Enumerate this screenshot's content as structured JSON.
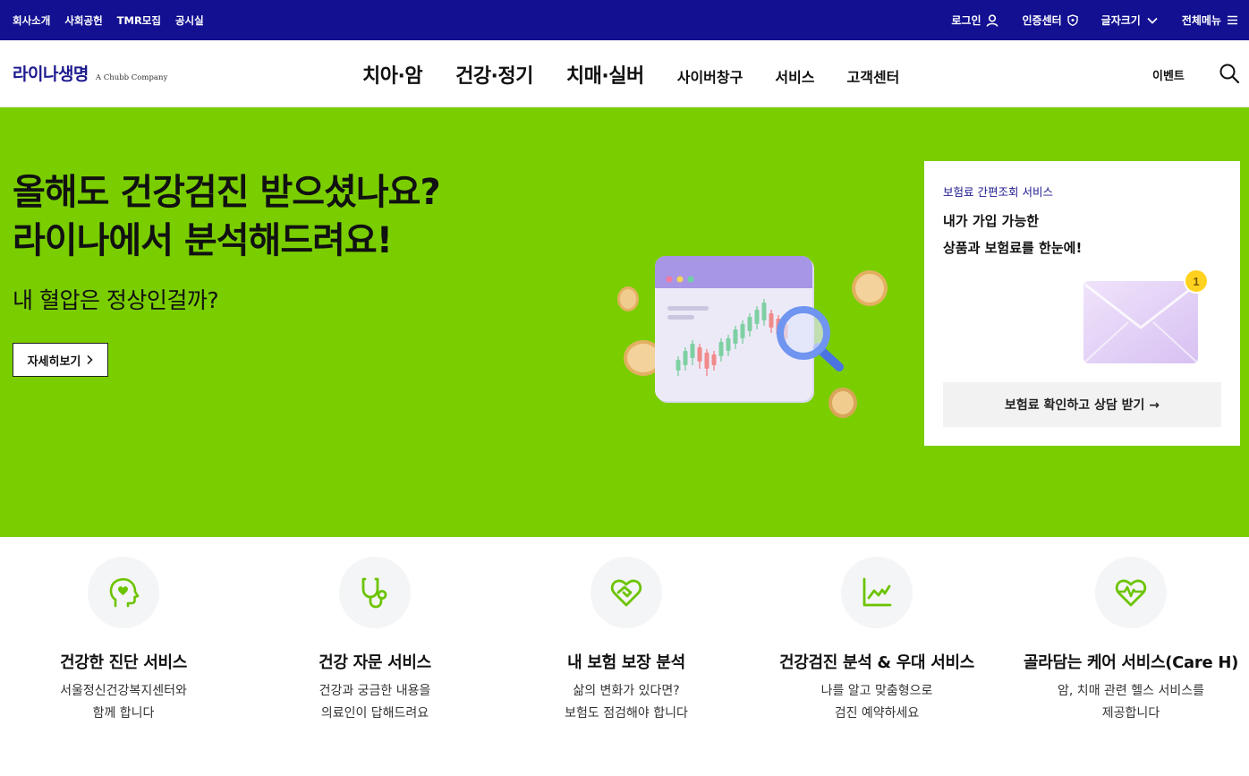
{
  "utility": {
    "links": [
      "회사소개",
      "사회공헌",
      "TMR모집",
      "공시실"
    ],
    "login": "로그인",
    "cert": "인증센터",
    "fontsize": "글자크기",
    "allmenu": "전체메뉴"
  },
  "header": {
    "brand": "라이나생명",
    "sub": "A Chubb Company",
    "nav_big": [
      "치아·암",
      "건강·정기",
      "치매·실버"
    ],
    "nav_small": [
      "사이버창구",
      "서비스",
      "고객센터"
    ],
    "event": "이벤트"
  },
  "hero": {
    "title_line1": "올해도 건강검진 받으셨나요?",
    "title_line2": "라이나에서 분석해드려요!",
    "subtitle": "내 혈압은 정상인걸까?",
    "more_label": "자세히보기",
    "background": "#7ace00"
  },
  "card": {
    "eyebrow": "보험료 간편조회 서비스",
    "title_line1": "내가 가입 가능한",
    "title_line2": "상품과 보험료를 한눈에!",
    "badge": "1",
    "cta": "보험료 확인하고 상담 받기 →"
  },
  "services": [
    {
      "icon": "head-heart-icon",
      "title": "건강한 진단 서비스",
      "desc1": "서울정신건강복지센터와",
      "desc2": "함께 합니다"
    },
    {
      "icon": "stethoscope-icon",
      "title": "건강 자문 서비스",
      "desc1": "건강과 궁금한 내용을",
      "desc2": "의료인이 답해드려요"
    },
    {
      "icon": "heart-handshake-icon",
      "title": "내 보험 보장 분석",
      "desc1": "삶의 변화가 있다면?",
      "desc2": "보험도 점검해야 합니다"
    },
    {
      "icon": "line-chart-icon",
      "title": "건강검진 분석 & 우대 서비스",
      "desc1": "나를 알고 맞춤형으로",
      "desc2": "검진 예약하세요"
    },
    {
      "icon": "heart-pulse-icon",
      "title": "골라담는 케어 서비스(Care H)",
      "desc1": "암, 치매 관련 헬스 서비스를",
      "desc2": "제공합니다"
    }
  ],
  "colors": {
    "navy": "#131091",
    "green": "#7ace00",
    "accent_icon": "#6cc400"
  }
}
